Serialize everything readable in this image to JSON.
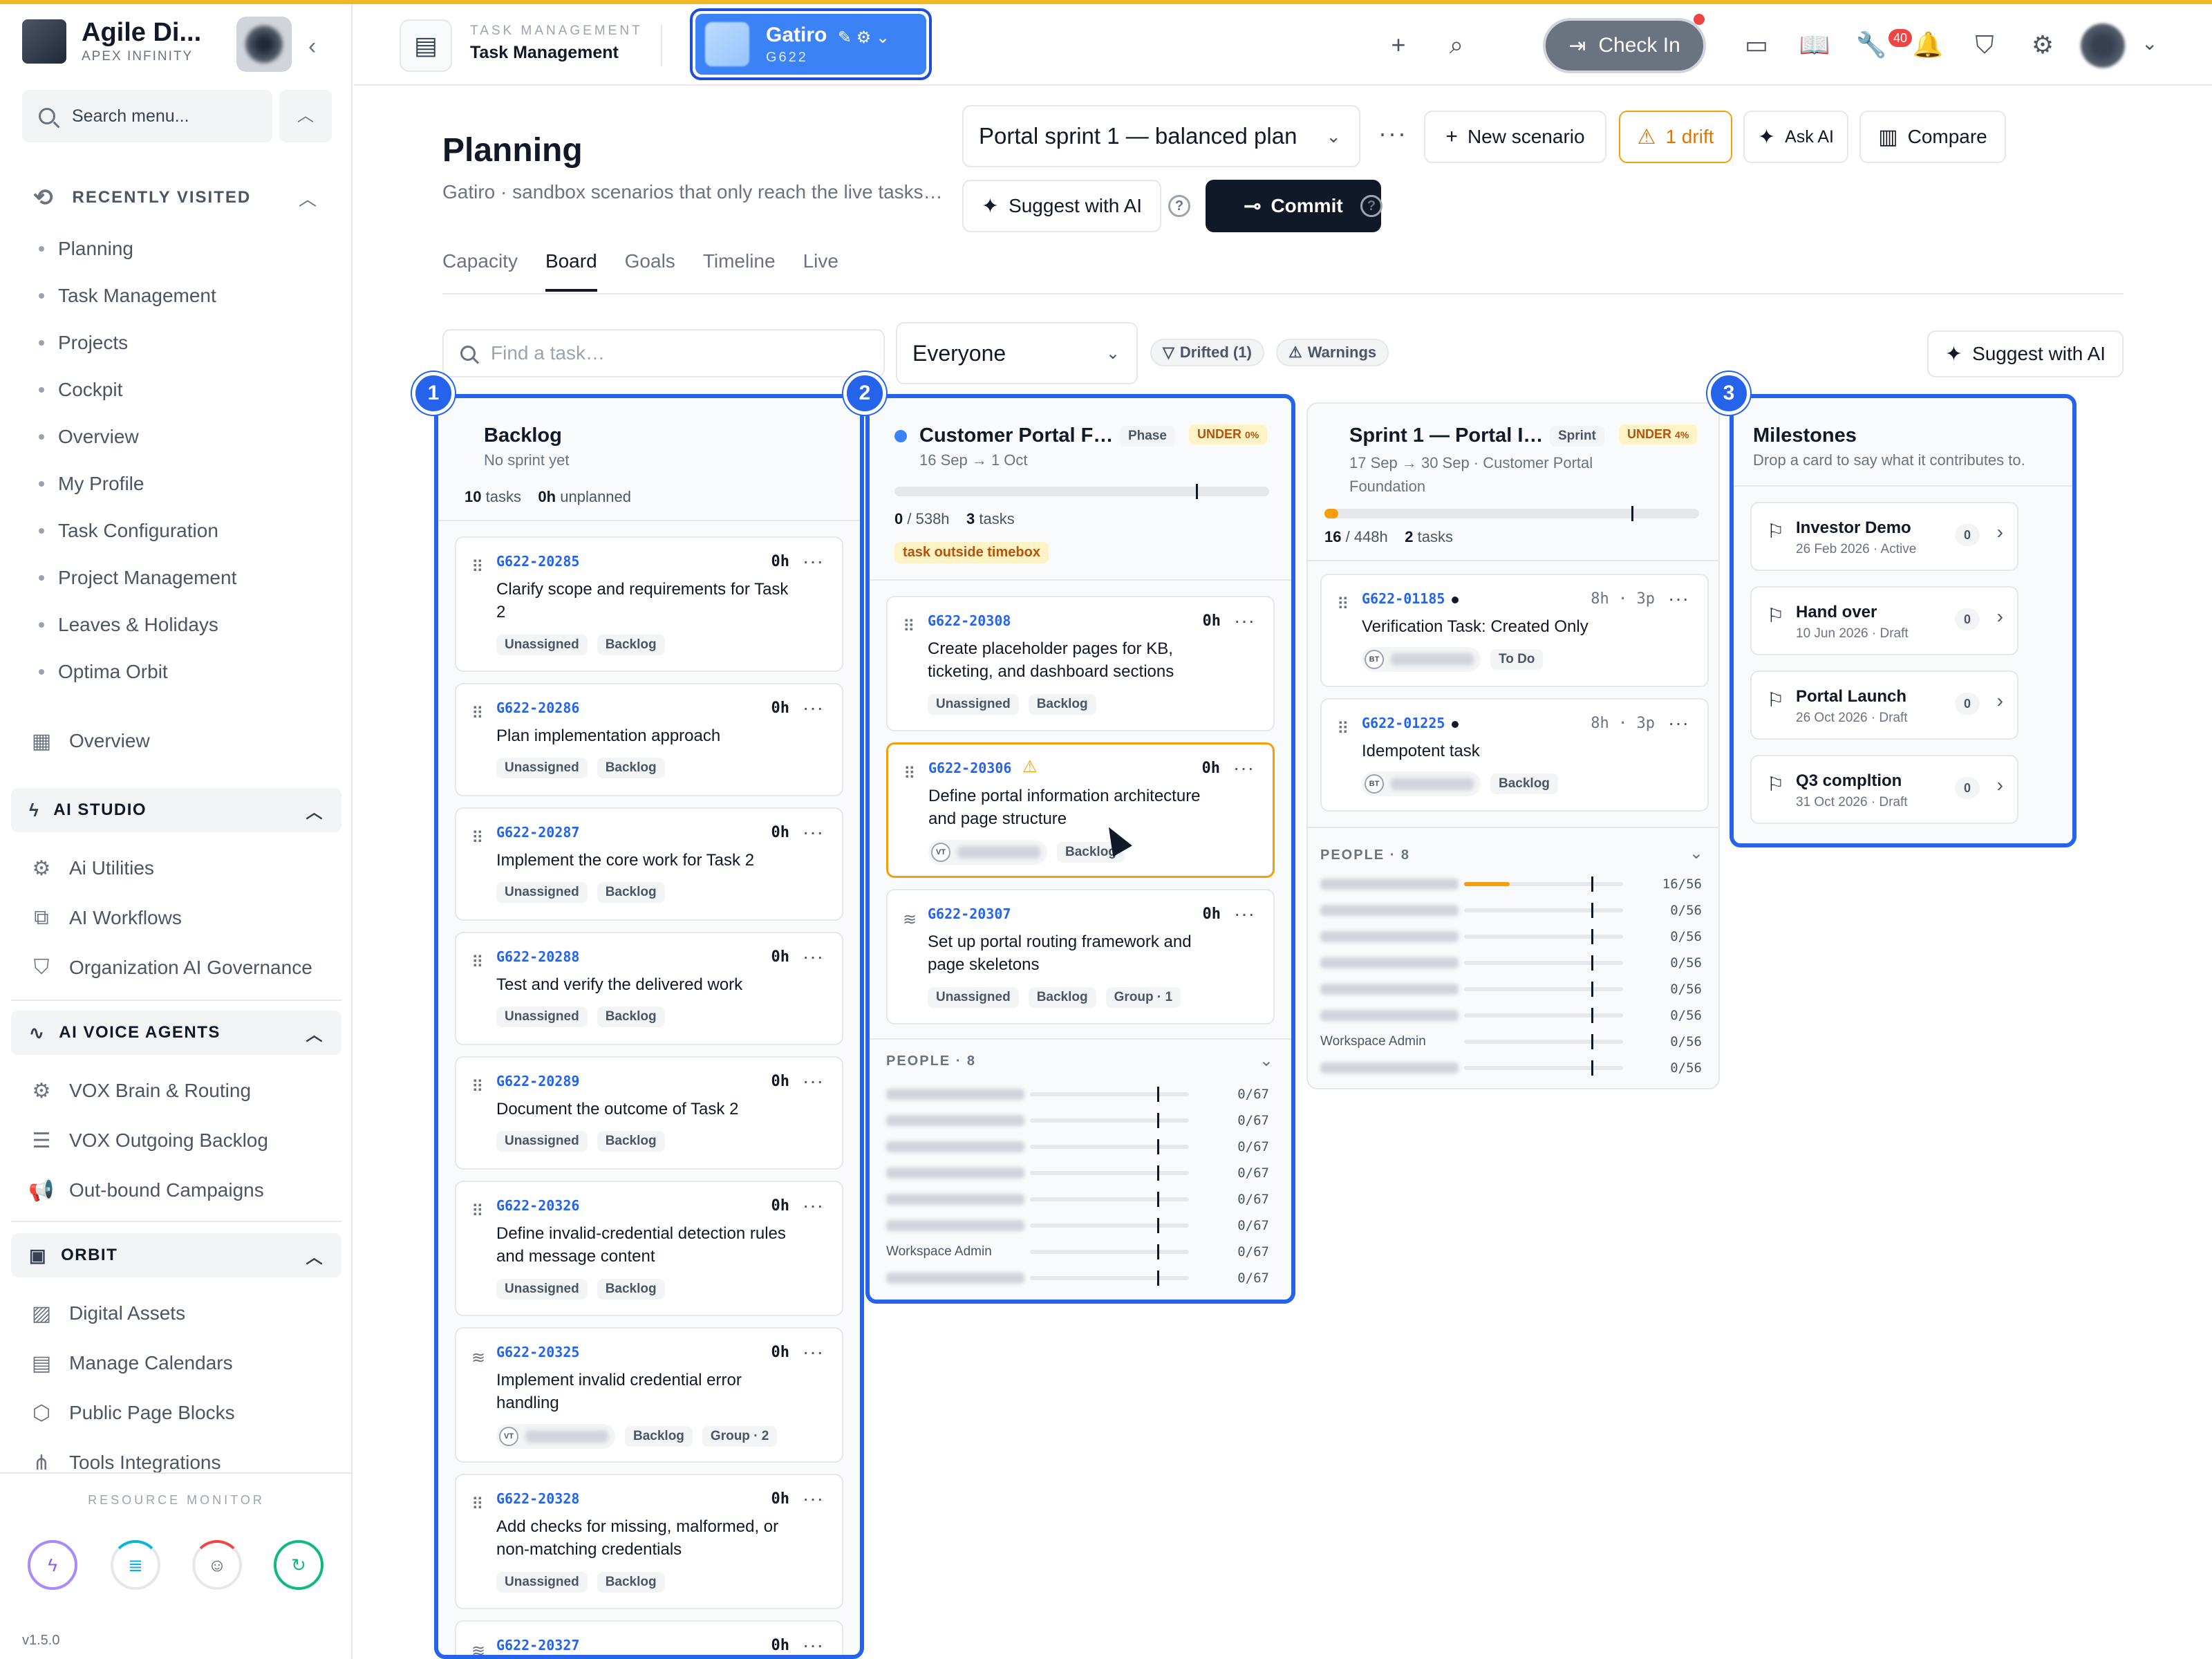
{
  "colors": {
    "accent": "#2563eb",
    "warning": "#f59e0b",
    "top_stripe": "#f2b824",
    "dark_button": "#111827"
  },
  "sidebar": {
    "brand_name": "Agile Di...",
    "brand_sub": "APEX INFINITY",
    "search_placeholder": "Search menu...",
    "recently_visited_label": "RECENTLY VISITED",
    "recent": [
      "Planning",
      "Task Management",
      "Projects",
      "Cockpit",
      "Overview",
      "My Profile",
      "Task Configuration",
      "Project Management",
      "Leaves & Holidays",
      "Optima Orbit"
    ],
    "overview_label": "Overview",
    "ai_studio_label": "AI STUDIO",
    "ai_studio_items": [
      "Ai Utilities",
      "AI Workflows",
      "Organization AI Governance"
    ],
    "ai_voice_label": "AI VOICE AGENTS",
    "ai_voice_items": [
      "VOX Brain & Routing",
      "VOX Outgoing Backlog",
      "Out-bound Campaigns"
    ],
    "orbit_label": "ORBIT",
    "orbit_items": [
      "Digital Assets",
      "Manage Calendars",
      "Public Page Blocks",
      "Tools Integrations"
    ],
    "resource_monitor_label": "RESOURCE MONITOR",
    "version": "v1.5.0"
  },
  "header": {
    "kicker": "TASK MANAGEMENT",
    "title": "Task Management",
    "project_name": "Gatiro",
    "project_code": "G622",
    "check_in_label": "Check In",
    "notification_count": "40"
  },
  "planning": {
    "title": "Planning",
    "subtitle": "Gatiro · sandbox scenarios that only reach the live tasks…",
    "scenario": "Portal sprint 1 — balanced plan",
    "new_scenario": "New scenario",
    "drift": "1 drift",
    "ask_ai": "Ask AI",
    "compare": "Compare",
    "suggest_ai": "Suggest with AI",
    "commit": "Commit",
    "tabs": [
      "Capacity",
      "Board",
      "Goals",
      "Timeline",
      "Live"
    ],
    "active_tab": "Board",
    "find_placeholder": "Find a task…",
    "filter_value": "Everyone",
    "chip_drifted": "Drifted (1)",
    "chip_warnings": "Warnings",
    "suggest_ai_right": "Suggest with AI"
  },
  "backlog": {
    "number": "1",
    "title": "Backlog",
    "sub": "No sprint yet",
    "tasks_count": "10",
    "tasks_label": "tasks",
    "unplanned_value": "0h",
    "unplanned_label": "unplanned",
    "cards": [
      {
        "id": "G622-20285",
        "hours": "0h",
        "title": "Clarify scope and requirements for Task 2",
        "assignee": "Unassigned",
        "status": "Backlog"
      },
      {
        "id": "G622-20286",
        "hours": "0h",
        "title": "Plan implementation approach",
        "assignee": "Unassigned",
        "status": "Backlog"
      },
      {
        "id": "G622-20287",
        "hours": "0h",
        "title": "Implement the core work for Task 2",
        "assignee": "Unassigned",
        "status": "Backlog"
      },
      {
        "id": "G622-20288",
        "hours": "0h",
        "title": "Test and verify the delivered work",
        "assignee": "Unassigned",
        "status": "Backlog"
      },
      {
        "id": "G622-20289",
        "hours": "0h",
        "title": "Document the outcome of Task 2",
        "assignee": "Unassigned",
        "status": "Backlog"
      },
      {
        "id": "G622-20326",
        "hours": "0h",
        "title": "Define invalid-credential detection rules and message content",
        "assignee": "Unassigned",
        "status": "Backlog"
      },
      {
        "id": "G622-20325",
        "hours": "0h",
        "title": "Implement invalid credential error handling",
        "assignee_initials": "VT",
        "status": "Backlog",
        "group": "Group · 2"
      },
      {
        "id": "G622-20328",
        "hours": "0h",
        "title": "Add checks for missing, malformed, or non-matching credentials",
        "assignee": "Unassigned",
        "status": "Backlog"
      },
      {
        "id": "G622-20327",
        "hours": "0h"
      }
    ]
  },
  "phase": {
    "number": "2",
    "title": "Customer Portal F…",
    "type": "Phase",
    "under_label": "UNDER",
    "under_pct": "0%",
    "dates": "16 Sep → 1 Oct",
    "used": "0",
    "capacity": "/ 538h",
    "tasks_count": "3",
    "tasks_label": "tasks",
    "progress_fraction": 0,
    "outside_label": "task outside timebox",
    "cards": [
      {
        "id": "G622-20308",
        "hours": "0h",
        "title": "Create placeholder pages for KB, ticketing, and dashboard sections",
        "assignee": "Unassigned",
        "status": "Backlog"
      },
      {
        "id": "G622-20306",
        "hours": "0h",
        "title": "Define portal information architecture and page structure",
        "assignee_initials": "VT",
        "status": "Backlog"
      },
      {
        "id": "G622-20307",
        "hours": "0h",
        "title": "Set up portal routing framework and page skeletons",
        "assignee": "Unassigned",
        "status": "Backlog",
        "group": "Group · 1"
      }
    ],
    "people_label": "PEOPLE · 8",
    "people": [
      {
        "name": "",
        "value": "0/67",
        "fill": 0
      },
      {
        "name": "",
        "value": "0/67",
        "fill": 0
      },
      {
        "name": "",
        "value": "0/67",
        "fill": 0
      },
      {
        "name": "",
        "value": "0/67",
        "fill": 0
      },
      {
        "name": "",
        "value": "0/67",
        "fill": 0
      },
      {
        "name": "",
        "value": "0/67",
        "fill": 0
      },
      {
        "name": "Workspace Admin",
        "value": "0/67",
        "fill": 0
      },
      {
        "name": "",
        "value": "0/67",
        "fill": 0
      }
    ]
  },
  "sprint": {
    "title": "Sprint 1 — Portal I…",
    "type": "Sprint",
    "under_label": "UNDER",
    "under_pct": "4%",
    "dates": "17 Sep → 30 Sep · Customer Portal Foundation",
    "used": "16",
    "capacity": "/ 448h",
    "tasks_count": "2",
    "tasks_label": "tasks",
    "progress_fraction": 0.036,
    "cards": [
      {
        "id": "G622-01185",
        "hours": "8h",
        "points": "3p",
        "title": "Verification Task: Created Only",
        "assignee_initials": "BT",
        "status": "To Do"
      },
      {
        "id": "G622-01225",
        "hours": "8h",
        "points": "3p",
        "title": "Idempotent task",
        "assignee_initials": "BT",
        "status": "Backlog"
      }
    ],
    "people_label": "PEOPLE · 8",
    "people": [
      {
        "name": "",
        "value": "16/56",
        "fill": 0.286
      },
      {
        "name": "",
        "value": "0/56",
        "fill": 0
      },
      {
        "name": "",
        "value": "0/56",
        "fill": 0
      },
      {
        "name": "",
        "value": "0/56",
        "fill": 0
      },
      {
        "name": "",
        "value": "0/56",
        "fill": 0
      },
      {
        "name": "",
        "value": "0/56",
        "fill": 0
      },
      {
        "name": "Workspace Admin",
        "value": "0/56",
        "fill": 0
      },
      {
        "name": "",
        "value": "0/56",
        "fill": 0
      }
    ]
  },
  "milestones": {
    "number": "3",
    "title": "Milestones",
    "sub": "Drop a card to say what it contributes to.",
    "items": [
      {
        "name": "Investor Demo",
        "meta": "26 Feb 2026 · Active",
        "count": "0"
      },
      {
        "name": "Hand over",
        "meta": "10 Jun 2026 · Draft",
        "count": "0"
      },
      {
        "name": "Portal Launch",
        "meta": "26 Oct 2026 · Draft",
        "count": "0"
      },
      {
        "name": "Q3 compltion",
        "meta": "31 Oct 2026 · Draft",
        "count": "0"
      }
    ]
  }
}
